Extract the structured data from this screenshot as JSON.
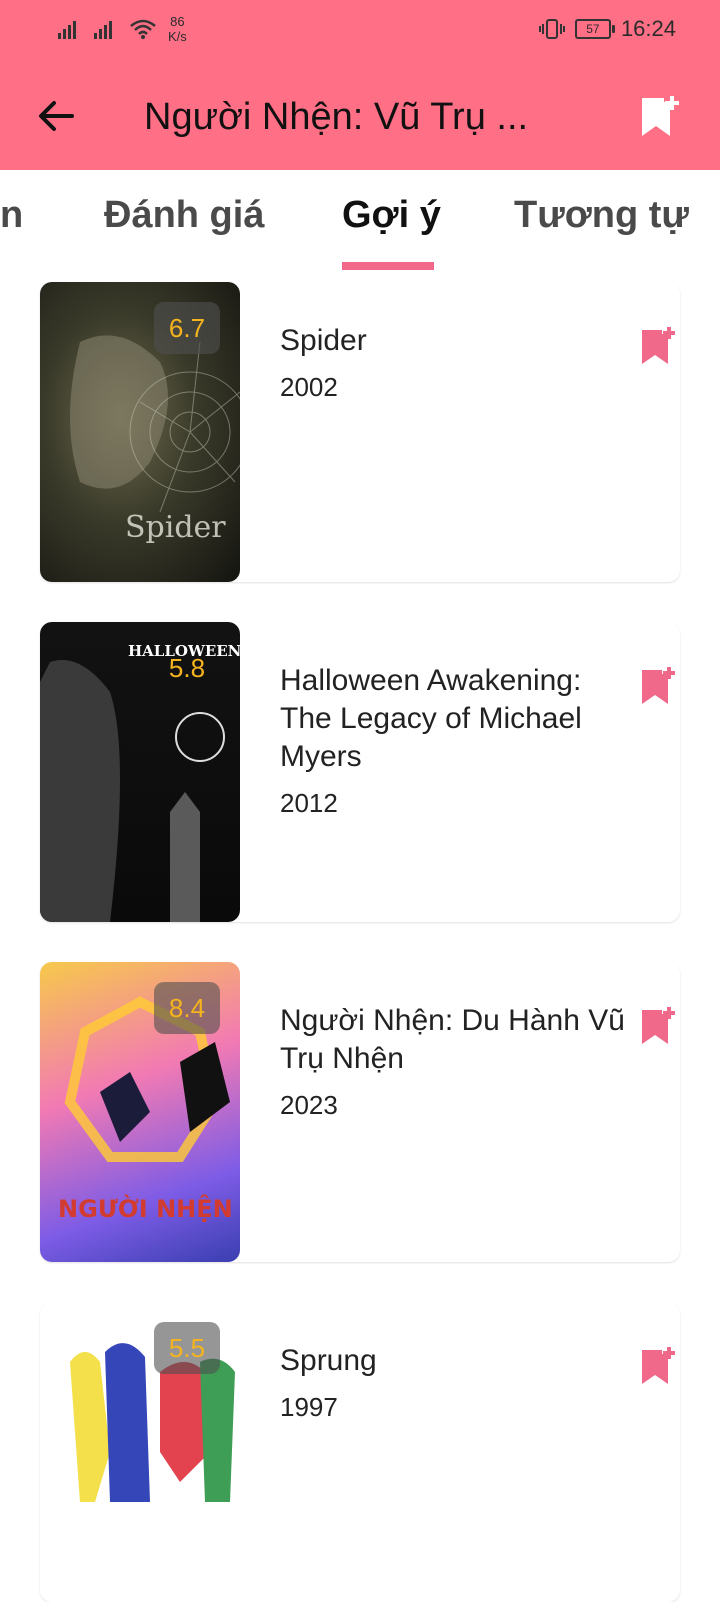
{
  "status_bar": {
    "net_speed_value": "86",
    "net_speed_unit": "K/s",
    "battery": "57",
    "time": "16:24"
  },
  "app_bar": {
    "title": "Người Nhện: Vũ Trụ ...",
    "back_icon": "arrow-left-icon",
    "bookmark_icon": "bookmark-add-icon"
  },
  "tabs": [
    {
      "label": "n"
    },
    {
      "label": "Đánh giá"
    },
    {
      "label": "Gợi ý",
      "active": true
    },
    {
      "label": "Tương tự"
    }
  ],
  "movies": [
    {
      "title": "Spider",
      "year": "2002",
      "rating": "6.7",
      "poster_text": "Spider"
    },
    {
      "title": "Halloween Awakening: The Legacy of Michael Myers",
      "year": "2012",
      "rating": "5.8",
      "poster_text": "HALLOWEEN AWAKENING"
    },
    {
      "title": "Người Nhện: Du Hành Vũ Trụ Nhện",
      "year": "2023",
      "rating": "8.4",
      "poster_text": "NGƯỜI NHỆN"
    },
    {
      "title": "Sprung",
      "year": "1997",
      "rating": "5.5",
      "poster_text": ""
    }
  ],
  "colors": {
    "primary": "#ff6f86",
    "accent": "#f0688a",
    "rating_text": "#f5b31e"
  }
}
